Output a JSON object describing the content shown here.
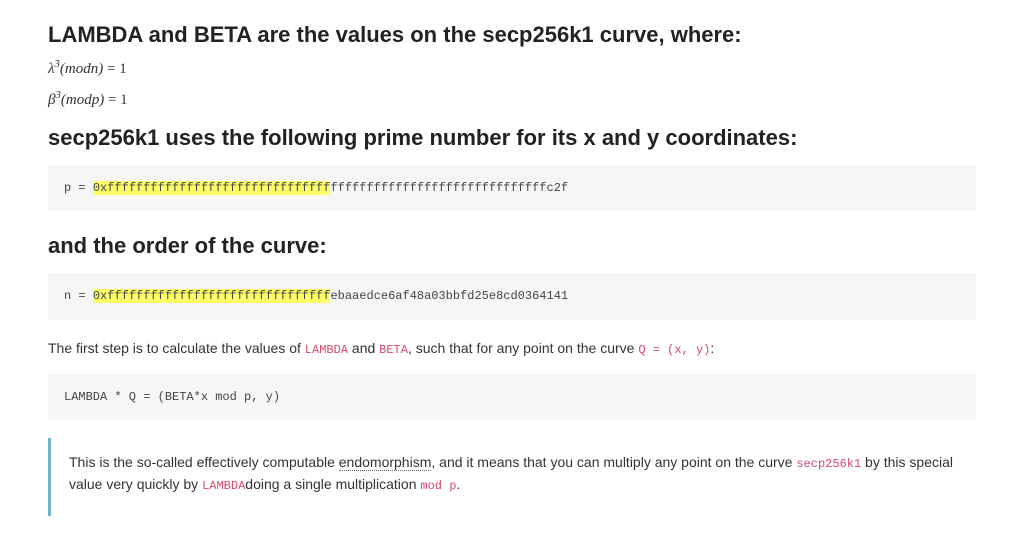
{
  "heading1": "LAMBDA and BETA are the values on the secp256k1 curve, where:",
  "math1_sym": "λ",
  "math1_sup": "3",
  "math1_mid": "(modn)",
  "math1_eq": " = 1",
  "math2_sym": "β",
  "math2_sup": "3",
  "math2_mid": "(modp)",
  "math2_eq": " = 1",
  "heading2": "secp256k1 uses the following prime number for its x and y coordinates:",
  "code_p": {
    "pre": "p = ",
    "hl": "0xfffffffffffffffffffffffffffffff",
    "rest": "ffffffffffffffffffffffffffffffc2f"
  },
  "heading3": "and the order of the curve:",
  "code_n": {
    "pre": "n = ",
    "hl": "0xfffffffffffffffffffffffffffffff",
    "rest": "ebaaedce6af48a03bbfd25e8cd0364141"
  },
  "para1": {
    "t1": "The first step is to calculate the values of ",
    "c1": "LAMBDA",
    "t2": " and ",
    "c2": "BETA",
    "t3": ", such that for any point on the curve ",
    "c3": "Q = (x, y)",
    "t4": ":"
  },
  "code_lambda": "LAMBDA * Q = (BETA*x mod p, y)",
  "quote": {
    "t1": "This is the so-called effectively computable ",
    "u1": "endomorphism",
    "t2": ", and it means that you can multiply any point on the curve ",
    "c1": "secp256k1",
    "t3": " by this special value very quickly by ",
    "c2": "LAMBDA",
    "t4": "doing a single multiplication ",
    "c3": "mod p",
    "t5": "."
  }
}
